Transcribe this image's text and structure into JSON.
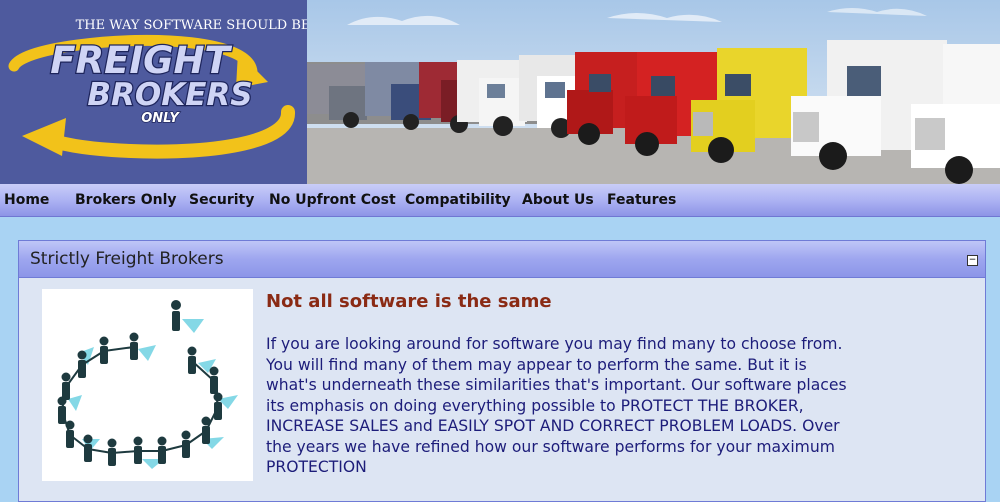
{
  "logo": {
    "tagline": "THE WAY SOFTWARE SHOULD BE",
    "word1": "FREIGHT",
    "word2": "BROKERS",
    "word3": "ONLY"
  },
  "nav": {
    "items": [
      {
        "label": "Home"
      },
      {
        "label": "Brokers Only"
      },
      {
        "label": "Security"
      },
      {
        "label": "No Upfront Cost"
      },
      {
        "label": "Compatibility"
      },
      {
        "label": "About Us"
      },
      {
        "label": "Features"
      }
    ]
  },
  "panel": {
    "title": "Strictly Freight Brokers",
    "collapse_symbol": "−",
    "heading": "Not all software is the same",
    "paragraph": "If you are looking around for software you may find many to choose from. You will find many of them may appear to perform the same. But it is what's underneath these similarities that's important. Our software places its emphasis on doing everything possible to PROTECT THE BROKER, INCREASE SALES and EASILY SPOT AND CORRECT PROBLEM LOADS. Over the years we have refined how our software performs for your maximum PROTECTION"
  },
  "colors": {
    "page_bg": "#a9d3f3",
    "logo_bg": "#4e5a9e",
    "logo_arrow": "#f2c21a",
    "heading": "#8a2a14",
    "body_text": "#1d1d7a"
  },
  "icons": {
    "logo_arrow": "curved-arrow-icon",
    "people_circle": "people-circle-illustration"
  }
}
